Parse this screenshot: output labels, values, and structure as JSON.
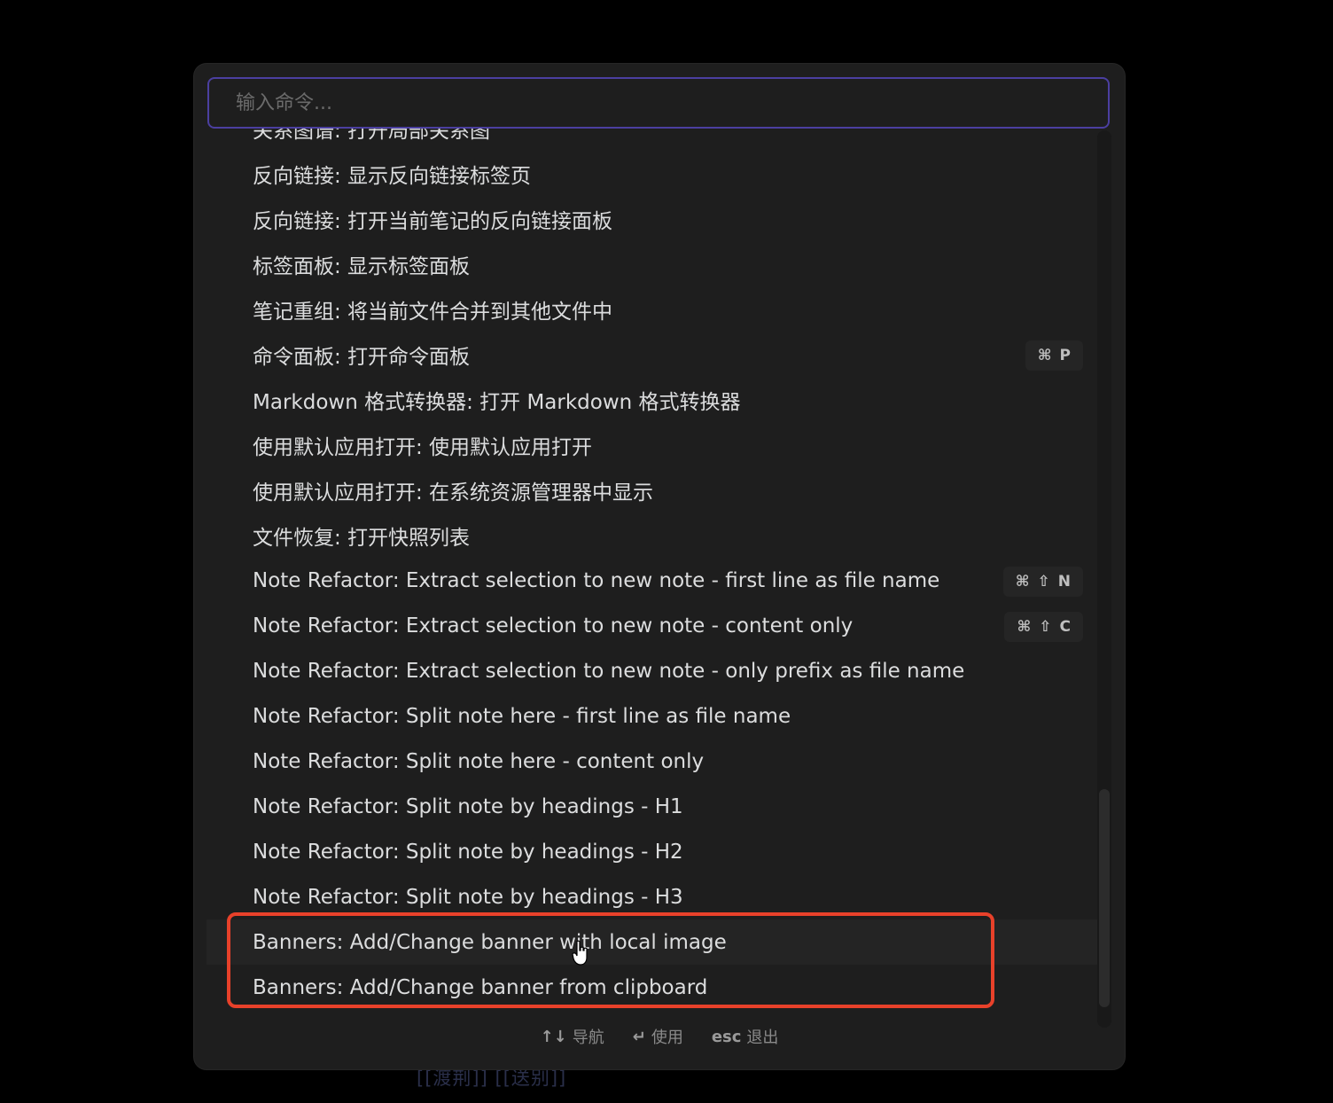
{
  "background_text": "[[渡荆]] [[送别]]",
  "search": {
    "placeholder": "输入命令..."
  },
  "items": [
    {
      "label": "关系图谱: 打开局部关系图"
    },
    {
      "label": "反向链接: 显示反向链接标签页"
    },
    {
      "label": "反向链接: 打开当前笔记的反向链接面板"
    },
    {
      "label": "标签面板: 显示标签面板"
    },
    {
      "label": "笔记重组: 将当前文件合并到其他文件中"
    },
    {
      "label": "命令面板: 打开命令面板",
      "hotkey": [
        "⌘",
        "P"
      ]
    },
    {
      "label": "Markdown 格式转换器: 打开 Markdown 格式转换器"
    },
    {
      "label": "使用默认应用打开: 使用默认应用打开"
    },
    {
      "label": "使用默认应用打开: 在系统资源管理器中显示"
    },
    {
      "label": "文件恢复: 打开快照列表"
    },
    {
      "label": "Note Refactor: Extract selection to new note - first line as file name",
      "hotkey": [
        "⌘",
        "⇧",
        "N"
      ]
    },
    {
      "label": "Note Refactor: Extract selection to new note - content only",
      "hotkey": [
        "⌘",
        "⇧",
        "C"
      ]
    },
    {
      "label": "Note Refactor: Extract selection to new note - only prefix as file name"
    },
    {
      "label": "Note Refactor: Split note here - first line as file name"
    },
    {
      "label": "Note Refactor: Split note here - content only"
    },
    {
      "label": "Note Refactor: Split note by headings - H1"
    },
    {
      "label": "Note Refactor: Split note by headings - H2"
    },
    {
      "label": "Note Refactor: Split note by headings - H3"
    },
    {
      "label": "Banners: Add/Change banner with local image",
      "selected": true
    },
    {
      "label": "Banners: Add/Change banner from clipboard"
    }
  ],
  "footer": {
    "navigate": {
      "key": "↑↓",
      "label": "导航"
    },
    "use": {
      "key": "↵",
      "label": "使用"
    },
    "dismiss": {
      "key": "esc",
      "label": "退出"
    }
  },
  "colors": {
    "accent_border": "#4b3fa0",
    "highlight_annotation": "#e8412a"
  }
}
